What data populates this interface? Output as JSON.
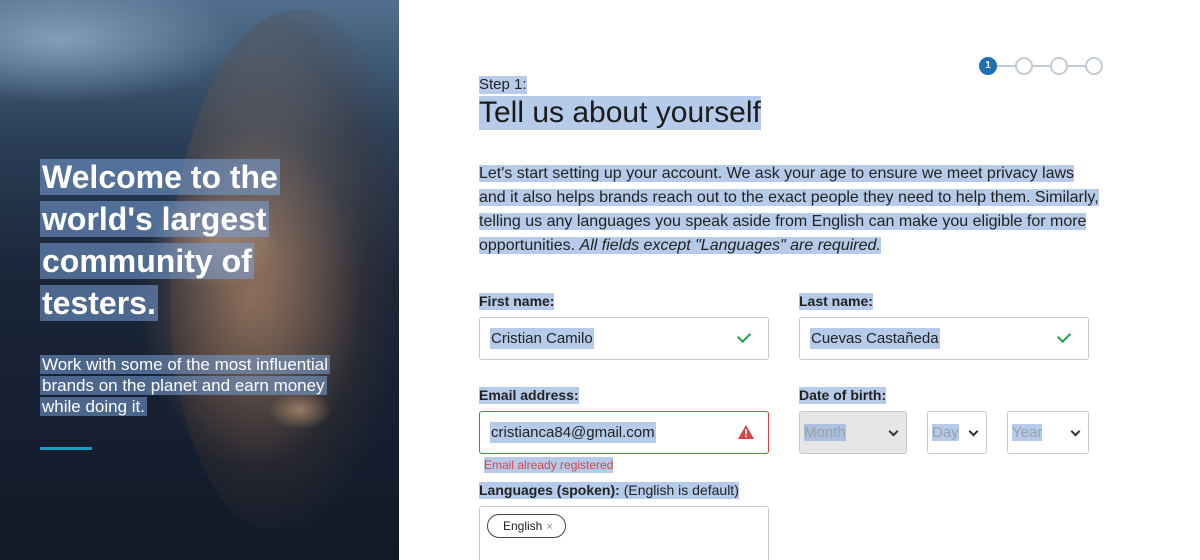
{
  "hero": {
    "title_lines": [
      "Welcome to the",
      "world's largest",
      "community of",
      "testers."
    ],
    "subtitle_lines": [
      "Work with some of the most influential",
      "brands on the planet and earn money",
      "while doing it."
    ],
    "accent_color": "#1aa0c0"
  },
  "steps": {
    "current": 1,
    "total": 4,
    "active_label": "1"
  },
  "form": {
    "step_label": "Step 1:",
    "title": "Tell us about yourself",
    "intro_text": "Let's start setting up your account. We ask your age to ensure we meet privacy laws and it also helps brands reach out to the exact people they need to help them. Similarly, telling us any languages you speak aside from English can make you eligible for more opportunities. ",
    "intro_note": "All fields except \"Languages\" are required.",
    "first_name": {
      "label": "First name:",
      "value": "Cristian Camilo",
      "status_icon": "check-icon"
    },
    "last_name": {
      "label": "Last name:",
      "value": "Cuevas Castañeda",
      "status_icon": "check-icon"
    },
    "email": {
      "label": "Email address:",
      "value": "cristianca84@gmail.com",
      "status_icon": "warning-icon",
      "error": "Email already registered"
    },
    "dob": {
      "label": "Date of birth:",
      "month_placeholder": "Month",
      "day_placeholder": "Day",
      "year_placeholder": "Year"
    },
    "languages": {
      "label": "Languages (spoken):",
      "hint": "(English is default)",
      "chips": [
        "English"
      ],
      "chip_remove": "×"
    }
  },
  "colors": {
    "primary": "#1f6fb5",
    "success": "#22a34a",
    "error": "#d64545",
    "selection": "#78a0d7"
  }
}
